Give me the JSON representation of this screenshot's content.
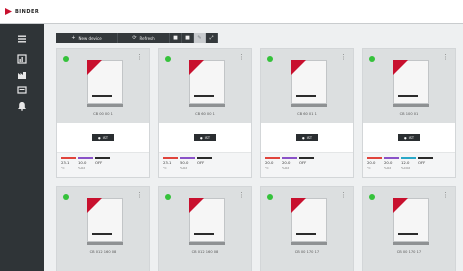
{
  "app": {
    "logo_text": "BINDER"
  },
  "sidebar": {
    "items": [
      {
        "icon": "menu-icon"
      },
      {
        "icon": "chart-icon"
      },
      {
        "icon": "factory-icon"
      },
      {
        "icon": "list-icon"
      },
      {
        "icon": "bell-icon"
      }
    ]
  },
  "toolbar": {
    "new_device_icon": "+",
    "new_device_label": "New device",
    "refresh_icon": "⟳",
    "refresh_label": "Refresh",
    "icon_buttons": [
      {
        "icon": "grid-view-icon",
        "glyph": "■"
      },
      {
        "icon": "list-view-icon",
        "glyph": "■"
      },
      {
        "icon": "edit-icon",
        "glyph": "✎"
      },
      {
        "icon": "expand-icon",
        "glyph": "⤢"
      }
    ]
  },
  "colors": {
    "accent": "#c8102e",
    "status_ok": "#35c23b",
    "sidebar": "#2f3437"
  },
  "cards_row1": [
    {
      "label": "CB 00 00 1",
      "button": "IST",
      "stats": [
        {
          "value": "23.1",
          "unit": "°C",
          "color": "#e0443c"
        },
        {
          "value": "10.0",
          "unit": "%O2",
          "color": "#8a52c8"
        },
        {
          "value": "OFF",
          "unit": "",
          "color": "#2a2a2a"
        }
      ]
    },
    {
      "label": "CB 60 00 1",
      "button": "IST",
      "stats": [
        {
          "value": "23.1",
          "unit": "°C",
          "color": "#e0443c"
        },
        {
          "value": "50.0",
          "unit": "%O2",
          "color": "#8a52c8"
        },
        {
          "value": "OFF",
          "unit": "",
          "color": "#2a2a2a"
        }
      ]
    },
    {
      "label": "CB 60 01 1",
      "button": "IST",
      "stats": [
        {
          "value": "20.0",
          "unit": "°C",
          "color": "#e0443c"
        },
        {
          "value": "20.0",
          "unit": "%O2",
          "color": "#8a52c8"
        },
        {
          "value": "OFF",
          "unit": "",
          "color": "#2a2a2a"
        }
      ]
    },
    {
      "label": "CB 100 01",
      "button": "IST",
      "stats": [
        {
          "value": "20.0",
          "unit": "°C",
          "color": "#e0443c"
        },
        {
          "value": "20.0",
          "unit": "%O2",
          "color": "#8a52c8"
        },
        {
          "value": "12.0",
          "unit": "%CO2",
          "color": "#2aa8c8"
        },
        {
          "value": "OFF",
          "unit": "",
          "color": "#2a2a2a"
        }
      ]
    }
  ],
  "cards_row2": [
    {
      "label": "CB 012 160 08"
    },
    {
      "label": "CB 012 160 08"
    },
    {
      "label": "CB 00 170 17"
    },
    {
      "label": "CB 00 170 17"
    }
  ]
}
